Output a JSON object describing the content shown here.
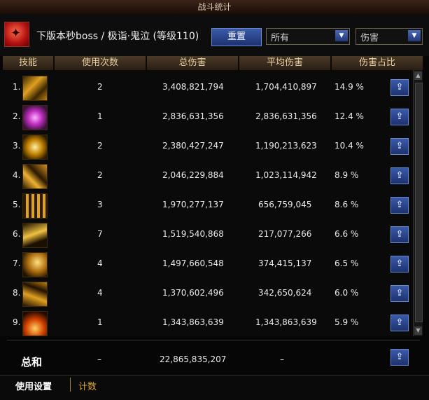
{
  "window": {
    "title": "战斗统计"
  },
  "header": {
    "boss_name": "下版本秒boss / 极诣·鬼泣 (等级110)",
    "reset_label": "重置",
    "filter_select": "所有",
    "type_select": "伤害"
  },
  "columns": [
    "技能",
    "使用次数",
    "总伤害",
    "平均伤害",
    "伤害占比"
  ],
  "rows": [
    {
      "idx": "1.",
      "uses": "2",
      "total": "3,408,821,794",
      "avg": "1,704,410,897",
      "pct": "14.9 %"
    },
    {
      "idx": "2.",
      "uses": "1",
      "total": "2,836,631,356",
      "avg": "2,836,631,356",
      "pct": "12.4 %"
    },
    {
      "idx": "3.",
      "uses": "2",
      "total": "2,380,427,247",
      "avg": "1,190,213,623",
      "pct": "10.4 %"
    },
    {
      "idx": "4.",
      "uses": "2",
      "total": "2,046,229,884",
      "avg": "1,023,114,942",
      "pct": "8.9 %"
    },
    {
      "idx": "5.",
      "uses": "3",
      "total": "1,970,277,137",
      "avg": "656,759,045",
      "pct": "8.6 %"
    },
    {
      "idx": "6.",
      "uses": "7",
      "total": "1,519,540,868",
      "avg": "217,077,266",
      "pct": "6.6 %"
    },
    {
      "idx": "7.",
      "uses": "4",
      "total": "1,497,660,548",
      "avg": "374,415,137",
      "pct": "6.5 %"
    },
    {
      "idx": "8.",
      "uses": "4",
      "total": "1,370,602,496",
      "avg": "342,650,624",
      "pct": "6.0 %"
    },
    {
      "idx": "9.",
      "uses": "1",
      "total": "1,343,863,639",
      "avg": "1,343,863,639",
      "pct": "5.9 %"
    }
  ],
  "total": {
    "label": "总和",
    "uses": "–",
    "total": "22,865,835,207",
    "avg": "–"
  },
  "footer": {
    "tab_settings": "使用设置",
    "tab_count": "计数"
  },
  "icons": {
    "share": "share-icon",
    "dropdown": "chevron-down-icon"
  },
  "colors": {
    "accent_blue": "#2a4a9a",
    "header_brown": "#3a2a1c",
    "tab_gold": "#d8a830"
  }
}
